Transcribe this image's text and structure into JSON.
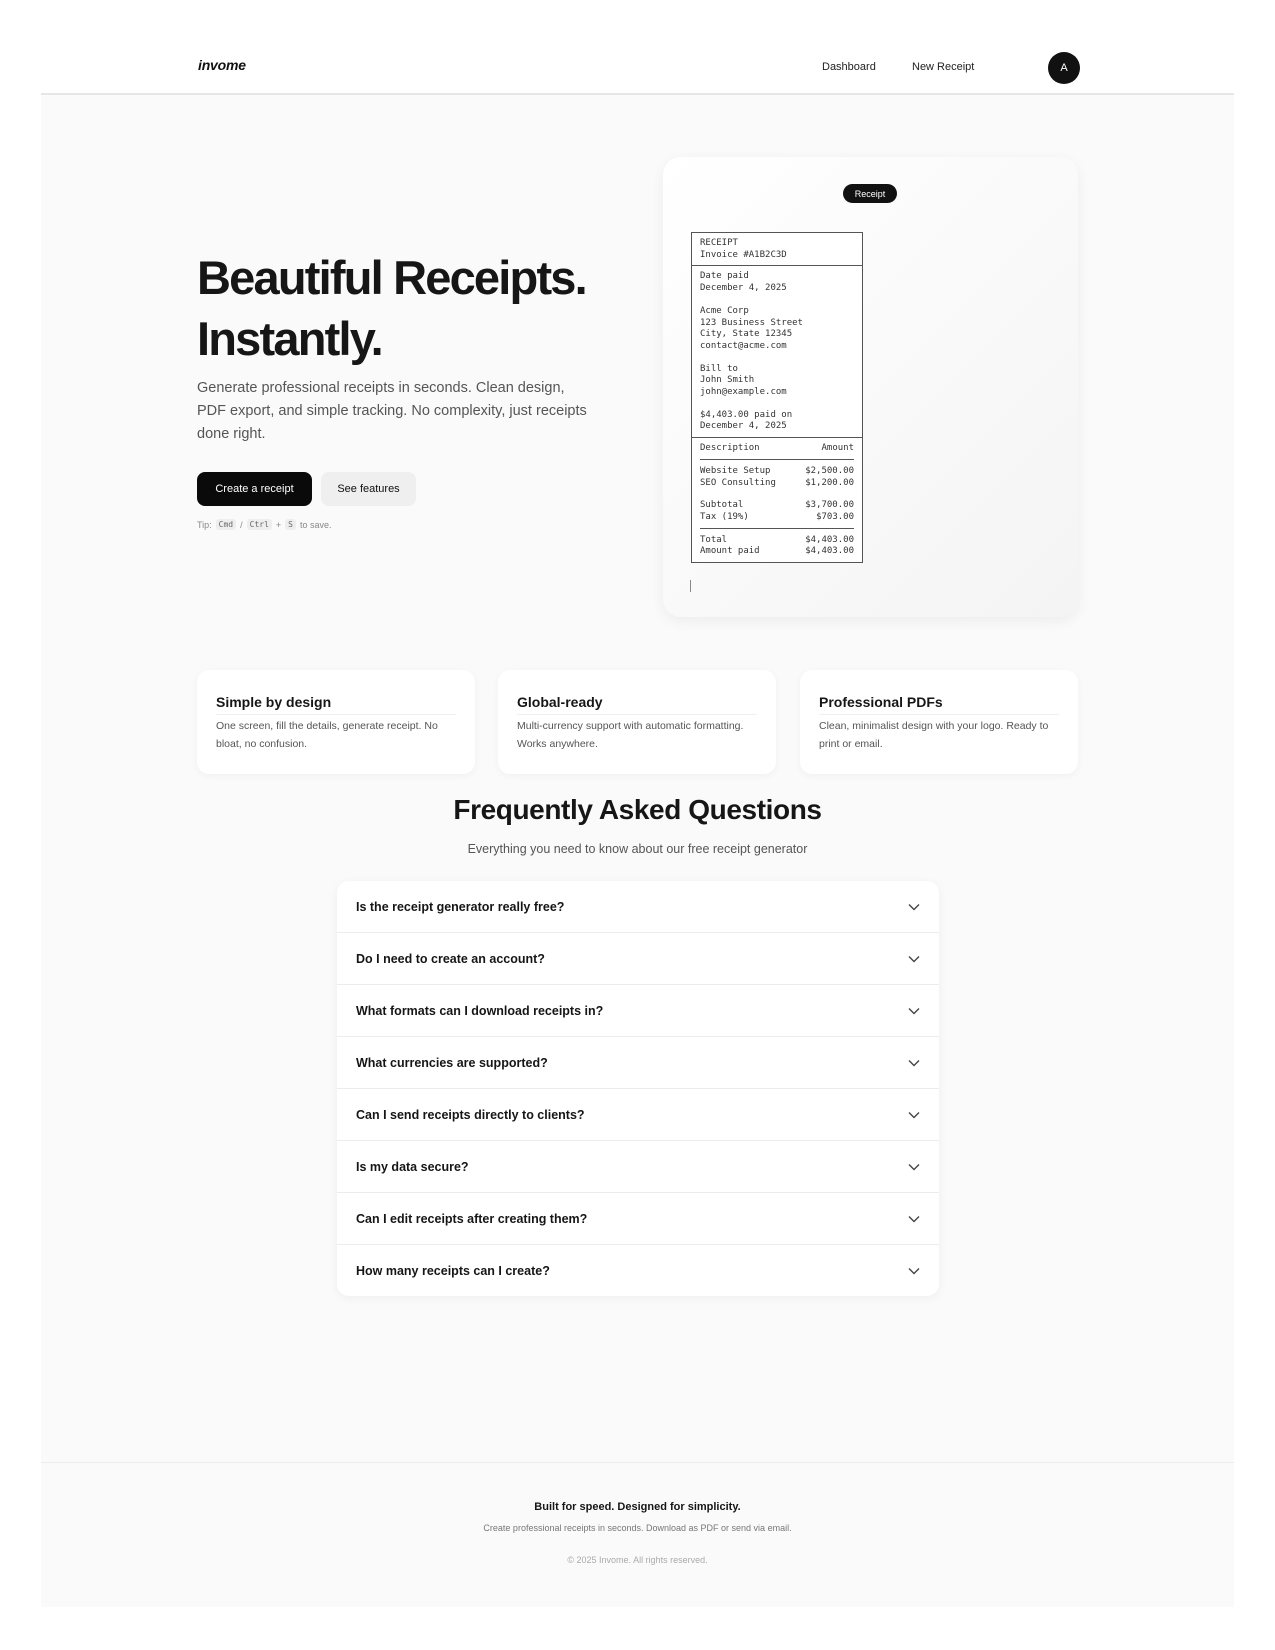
{
  "header": {
    "logo": "invome",
    "nav": [
      "Dashboard",
      "New Receipt"
    ],
    "avatar_initial": "A"
  },
  "hero": {
    "title_line1": "Beautiful Receipts.",
    "title_line2": "Instantly.",
    "subtitle": "Generate professional receipts in seconds. Clean design, PDF export, and simple tracking. No complexity, just receipts done right.",
    "primary_button": "Create a receipt",
    "secondary_button": "See features",
    "tip": {
      "prefix": "Tip:",
      "key1": "Cmd",
      "slash": "/",
      "key2": "Ctrl",
      "plus": "+",
      "key3": "S",
      "suffix": "to save."
    }
  },
  "preview": {
    "badge": "Receipt",
    "receipt": {
      "heading": "RECEIPT",
      "invoice": "Invoice #A1B2C3D",
      "date_label": "Date paid",
      "date_value": "December 4, 2025",
      "company_name": "Acme Corp",
      "company_street": "123 Business Street",
      "company_city": "City, State 12345",
      "company_email": "contact@acme.com",
      "bill_to_label": "Bill to",
      "bill_to_name": "John Smith",
      "bill_to_email": "john@example.com",
      "paid_line1": "$4,403.00 paid on",
      "paid_line2": "December 4, 2025",
      "col_description": "Description",
      "col_amount": "Amount",
      "items": [
        {
          "description": "Website Setup",
          "amount": "$2,500.00"
        },
        {
          "description": "SEO Consulting",
          "amount": "$1,200.00"
        }
      ],
      "subtotal_label": "Subtotal",
      "subtotal_value": "$3,700.00",
      "tax_label": "Tax (19%)",
      "tax_value": "$703.00",
      "total_label": "Total",
      "total_value": "$4,403.00",
      "amount_paid_label": "Amount paid",
      "amount_paid_value": "$4,403.00"
    }
  },
  "features": [
    {
      "title": "Simple by design",
      "text": "One screen, fill the details, generate receipt. No bloat, no confusion."
    },
    {
      "title": "Global-ready",
      "text": "Multi-currency support with automatic formatting. Works anywhere."
    },
    {
      "title": "Professional PDFs",
      "text": "Clean, minimalist design with your logo. Ready to print or email."
    }
  ],
  "faq": {
    "title": "Frequently Asked Questions",
    "subtitle": "Everything you need to know about our free receipt generator",
    "questions": [
      "Is the receipt generator really free?",
      "Do I need to create an account?",
      "What formats can I download receipts in?",
      "What currencies are supported?",
      "Can I send receipts directly to clients?",
      "Is my data secure?",
      "Can I edit receipts after creating them?",
      "How many receipts can I create?"
    ]
  },
  "footer": {
    "headline": "Built for speed. Designed for simplicity.",
    "text": "Create professional receipts in seconds. Download as PDF or send via email.",
    "copyright": "© 2025 Invome. All rights reserved."
  }
}
